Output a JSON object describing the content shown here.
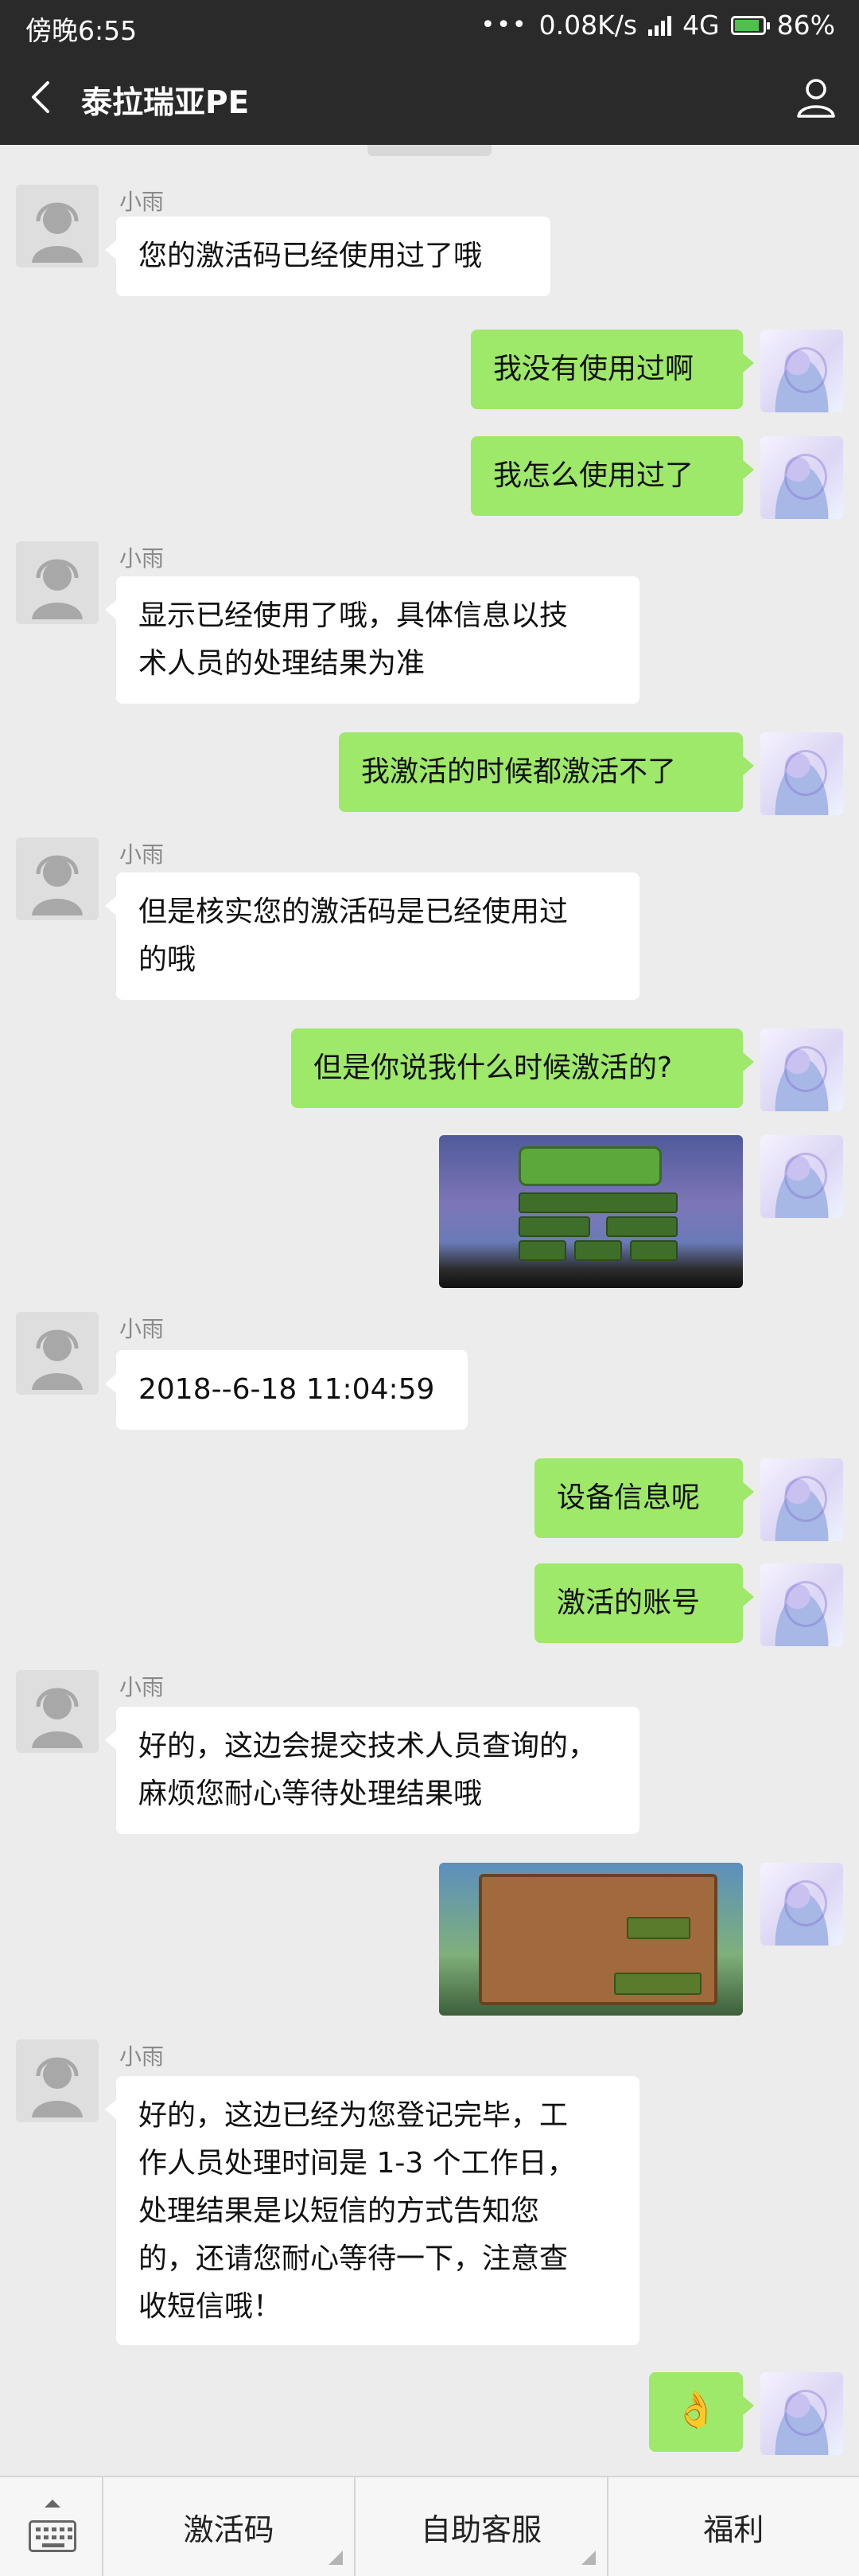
{
  "status_bar": {
    "time": "傍晚6:55",
    "dots": "•••",
    "speed": "0.08K/s",
    "network": "4G",
    "battery": "86%"
  },
  "header": {
    "title": "泰拉瑞亚PE"
  },
  "messages": [
    {
      "from": "agent",
      "sender": "小雨",
      "text": "您的激活码已经使用过了哦"
    },
    {
      "from": "user",
      "text": "我没有使用过啊"
    },
    {
      "from": "user",
      "text": "我怎么使用过了"
    },
    {
      "from": "agent",
      "sender": "小雨",
      "text": "显示已经使用了哦，具体信息以技\n术人员的处理结果为准"
    },
    {
      "from": "user",
      "text": "我激活的时候都激活不了"
    },
    {
      "from": "agent",
      "sender": "小雨",
      "text": "但是核实您的激活码是已经使用过\n的哦"
    },
    {
      "from": "user",
      "text": "但是你说我什么时候激活的?"
    },
    {
      "from": "user",
      "type": "image"
    },
    {
      "from": "agent",
      "sender": "小雨",
      "text": "2018--6-18 11:04:59"
    },
    {
      "from": "user",
      "text": "设备信息呢"
    },
    {
      "from": "user",
      "text": "激活的账号"
    },
    {
      "from": "agent",
      "sender": "小雨",
      "text": "好的，这边会提交技术人员查询的，\n麻烦您耐心等待处理结果哦"
    },
    {
      "from": "user",
      "type": "image"
    },
    {
      "from": "agent",
      "sender": "小雨",
      "text": "好的，这边已经为您登记完毕，工\n作人员处理时间是 1-3 个工作日，\n处理结果是以短信的方式告知您\n的，还请您耐心等待一下，注意查\n收短信哦！"
    },
    {
      "from": "user",
      "text": "👌"
    }
  ],
  "bottom_menu": {
    "items": [
      "激活码",
      "自助客服",
      "福利"
    ]
  }
}
